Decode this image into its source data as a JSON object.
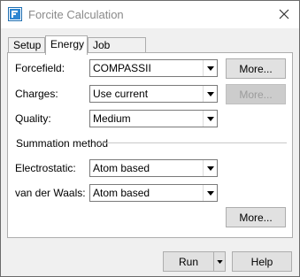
{
  "window": {
    "title": "Forcite Calculation"
  },
  "tabs": [
    {
      "label": "Setup"
    },
    {
      "label": "Energy"
    },
    {
      "label": "Job Control"
    }
  ],
  "energy": {
    "forcefield": {
      "label": "Forcefield:",
      "value": "COMPASSII",
      "more_label": "More..."
    },
    "charges": {
      "label": "Charges:",
      "value": "Use current",
      "more_label": "More..."
    },
    "quality": {
      "label": "Quality:",
      "value": "Medium"
    },
    "summation": {
      "heading": "Summation method",
      "electrostatic": {
        "label": "Electrostatic:",
        "value": "Atom based"
      },
      "vdw": {
        "label": "van der Waals:",
        "value": "Atom based"
      },
      "more_label": "More..."
    }
  },
  "footer": {
    "run_label": "Run",
    "help_label": "Help"
  },
  "icons": {
    "app": "forcite-app-icon",
    "close": "close-icon",
    "dropdown": "chevron-down-icon"
  }
}
